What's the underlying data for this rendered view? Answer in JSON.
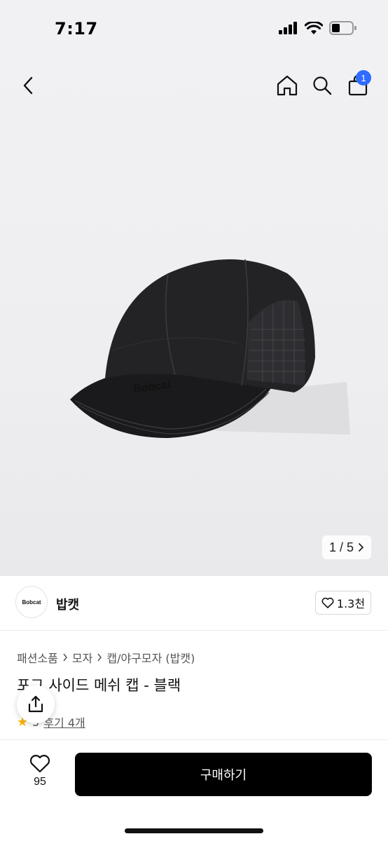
{
  "status_bar": {
    "time": "7:17",
    "icons": [
      "signal-icon",
      "wifi-icon",
      "battery-icon"
    ]
  },
  "nav": {
    "icons": [
      "chevron-left-icon",
      "home-icon",
      "search-icon",
      "shopping-bag-icon"
    ],
    "cart_badge": "1"
  },
  "gallery": {
    "counter": "1 / 5",
    "image_subject": "black cap",
    "printed_logo": "Bobcat"
  },
  "brand": {
    "logo_text": "Bobcat",
    "name": "밥캣",
    "like_count": "1.3천"
  },
  "breadcrumb": [
    "패션소품",
    "모자",
    "캡/야구모자 (밥캣)"
  ],
  "product": {
    "title": "포그 사이드 메쉬 캡 - 블랙",
    "rating": "5",
    "review_label": "후기 4개"
  },
  "bottom_bar": {
    "wish_count": "95",
    "buy_label": "구매하기"
  },
  "colors": {
    "accent": "#2f6bff",
    "buy_button": "#000000",
    "star": "#ffb100"
  }
}
